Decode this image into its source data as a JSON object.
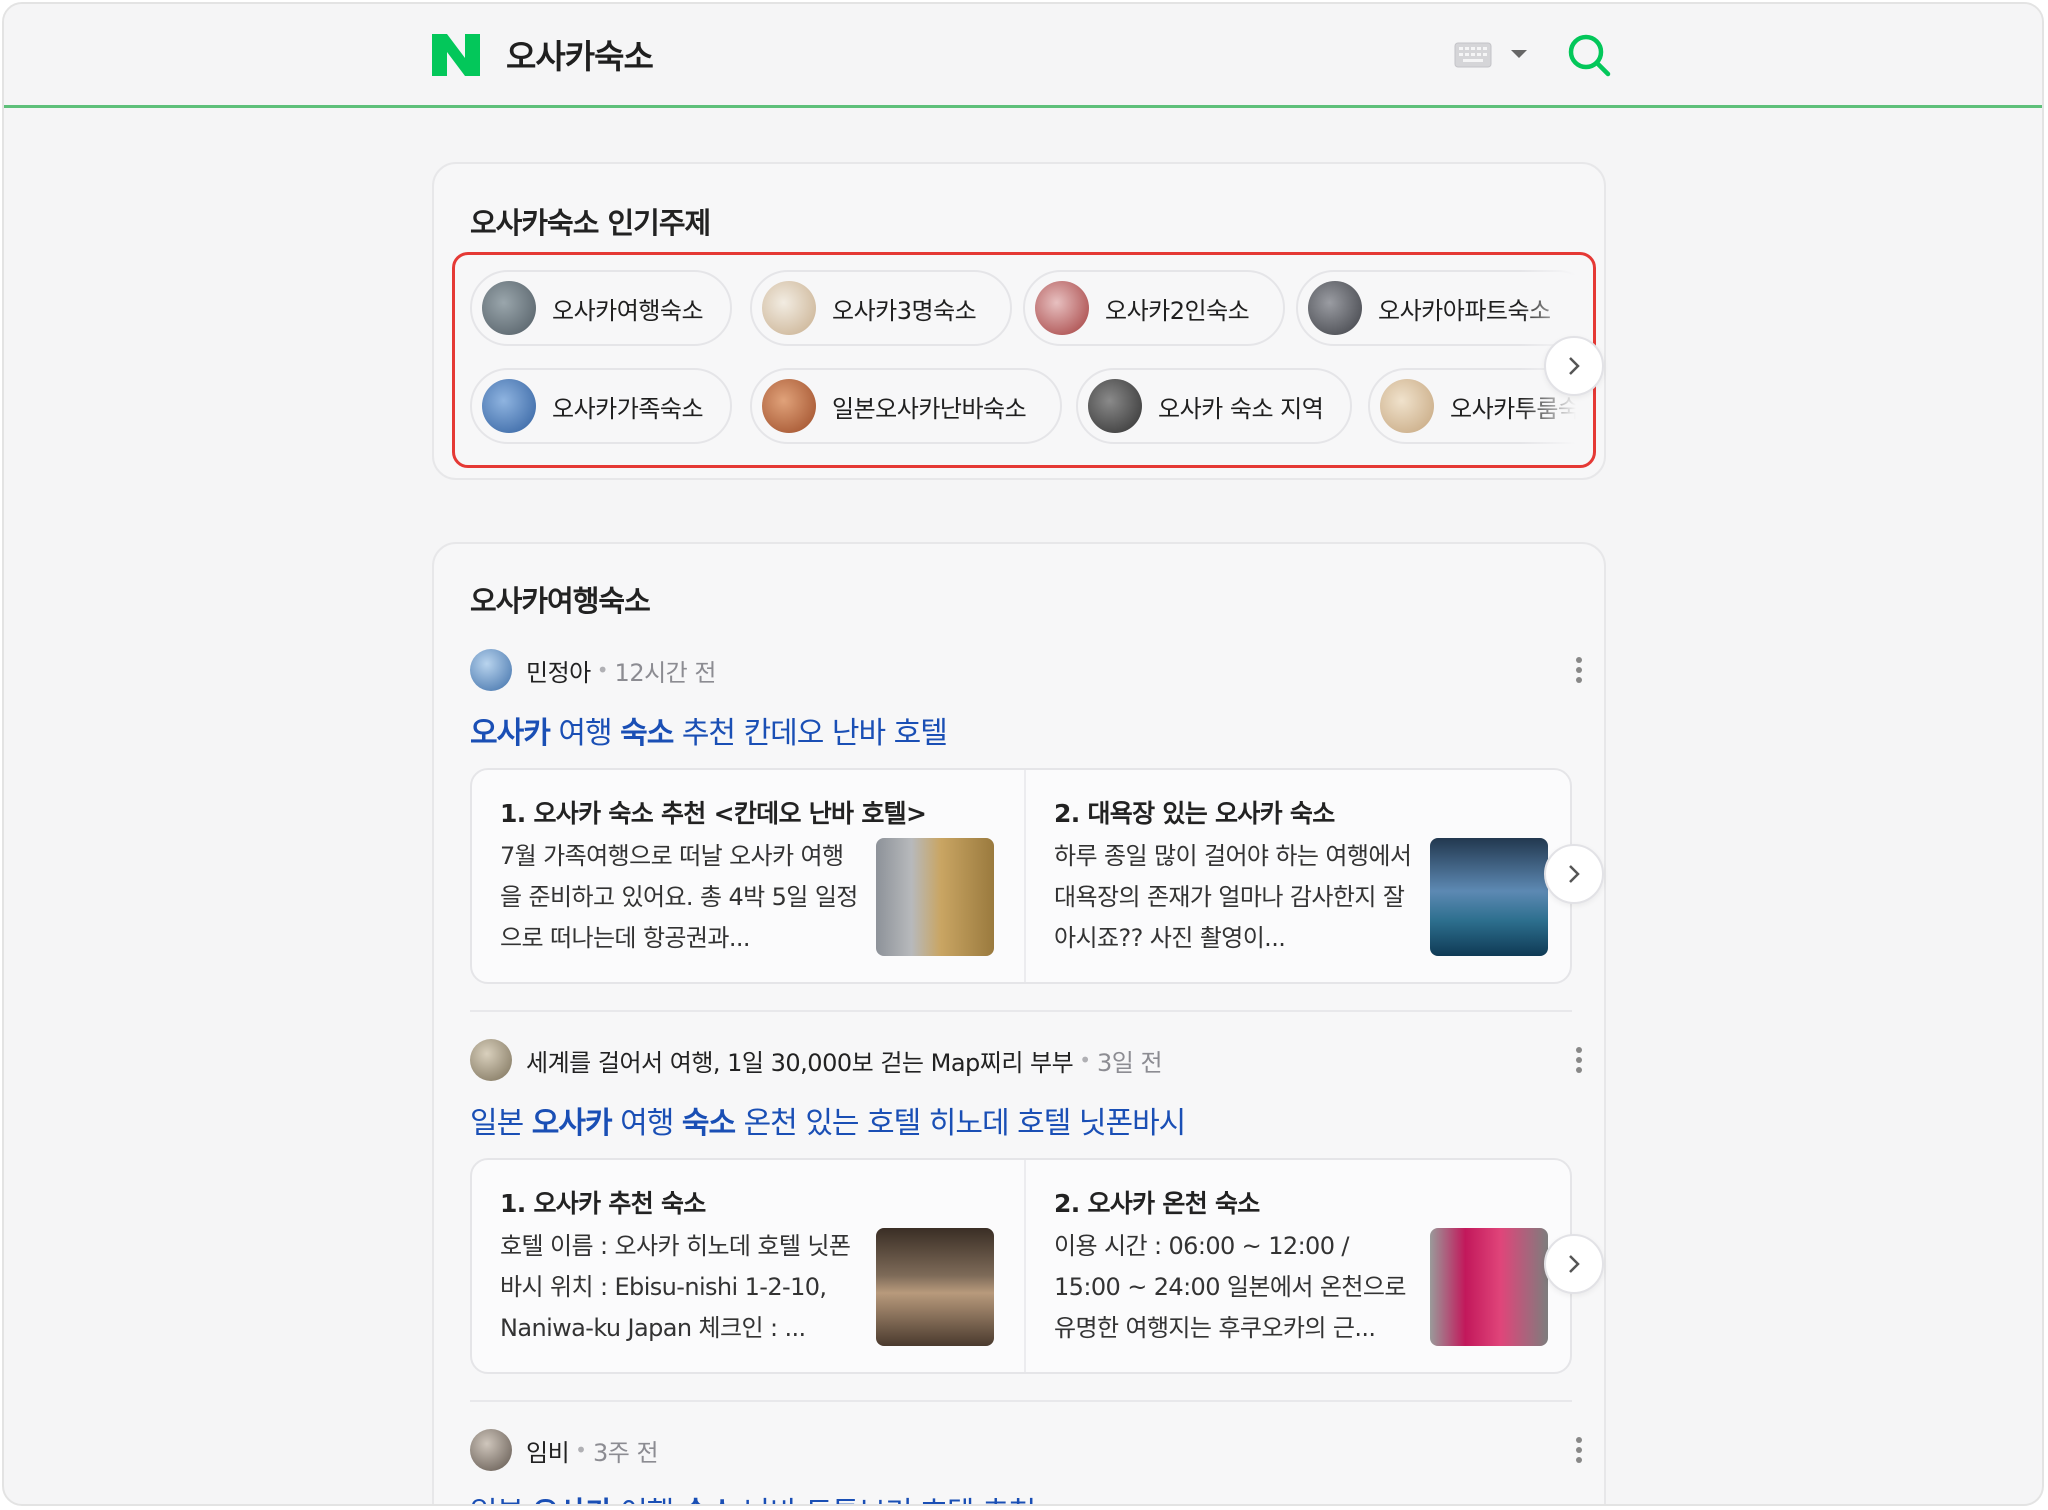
{
  "header": {
    "logo_letter": "N",
    "query": "오사카숙소",
    "icons": [
      "keyboard-icon",
      "caret-down-icon",
      "search-icon"
    ],
    "brand_color": "#03c75a"
  },
  "topics": {
    "title": "오사카숙소 인기주제",
    "row1": [
      {
        "label": "오사카여행숙소",
        "thumb": "#6e7a82"
      },
      {
        "label": "오사카3명숙소",
        "thumb": "#d9c8b0"
      },
      {
        "label": "오사카2인숙소",
        "thumb": "#b84a4a"
      },
      {
        "label": "오사카아파트숙소",
        "thumb": "#55575c"
      }
    ],
    "row2": [
      {
        "label": "오사카가족숙소",
        "thumb": "#3c6fb4"
      },
      {
        "label": "일본오사카난바숙소",
        "thumb": "#b5572e"
      },
      {
        "label": "오사카 숙소 지역",
        "thumb": "#444"
      },
      {
        "label": "오사카투룸숙소",
        "thumb": "#d8c2a3"
      }
    ]
  },
  "section": {
    "title": "오사카여행숙소",
    "posts": [
      {
        "author": "민정아",
        "time": "12시간 전",
        "title_parts": [
          {
            "text": "오사카",
            "bold": true
          },
          {
            "text": " 여행 ",
            "bold": false
          },
          {
            "text": "숙소",
            "bold": true
          },
          {
            "text": " 추천 칸데오 난바 호텔",
            "bold": false
          }
        ],
        "previews": [
          {
            "title": "1. 오사카 숙소 추천 <칸데오 난바 호텔>",
            "text": "7월 가족여행으로 떠날 오사카 여행을 준비하고 있어요. 총 4박 5일 일정으로 떠나는데 항공권과...",
            "thumb": "#b89a5e"
          },
          {
            "title": "2. 대욕장 있는 오사카 숙소",
            "text": "하루 종일 많이 걸어야 하는 여행에서 대욕장의 존재가 얼마나 감사한지 잘 아시죠?? 사진 촬영이...",
            "thumb": "#3d6f9c"
          }
        ]
      },
      {
        "author": "세계를 걸어서 여행, 1일 30,000보 걷는 Map찌리 부부",
        "time": "3일 전",
        "title_parts": [
          {
            "text": "일본 ",
            "bold": false
          },
          {
            "text": "오사카",
            "bold": true
          },
          {
            "text": " 여행 ",
            "bold": false
          },
          {
            "text": "숙소",
            "bold": true
          },
          {
            "text": " 온천 있는 호텔 히노데 호텔 닛폰바시",
            "bold": false
          }
        ],
        "previews": [
          {
            "title": "1. 오사카 추천 숙소",
            "text": "호텔 이름 : 오사카 히노데 호텔 닛폰바시 위치 : Ebisu-nishi 1-2-10, Naniwa-ku Japan 체크인 : ...",
            "thumb": "#5a4a3c"
          },
          {
            "title": "2. 오사카 온천 숙소",
            "text": "이용 시간 : 06:00 ~ 12:00 / 15:00 ~ 24:00 일본에서 온천으로 유명한 여행지는 후쿠오카의 근...",
            "thumb": "#8c8c8c"
          }
        ]
      },
      {
        "author": "임비",
        "time": "3주 전",
        "title_parts": [
          {
            "text": "일본 ",
            "bold": false
          },
          {
            "text": "오사카",
            "bold": true
          },
          {
            "text": " 여행 ",
            "bold": false
          },
          {
            "text": "숙소",
            "bold": true
          },
          {
            "text": " 난바 도톤보리 호텔 추천",
            "bold": false
          }
        ]
      }
    ]
  }
}
